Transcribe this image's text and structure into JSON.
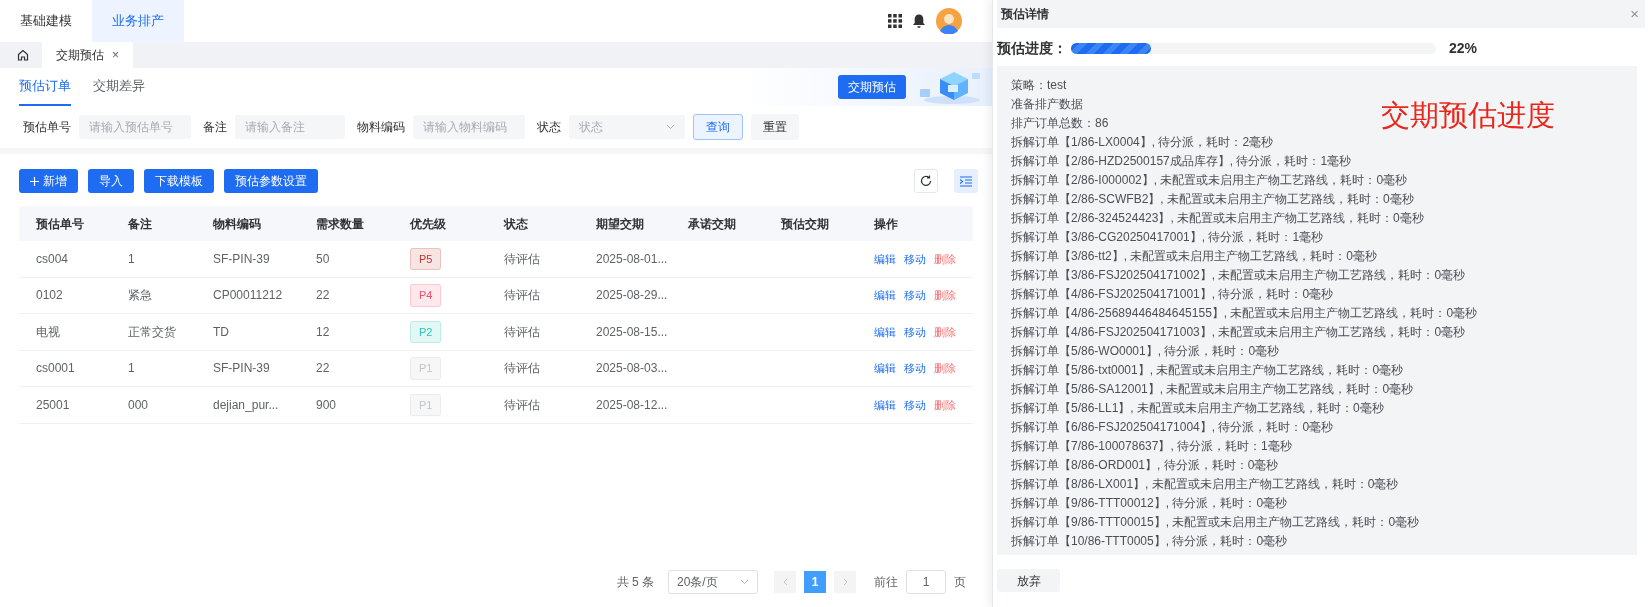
{
  "top_nav": [
    {
      "label": "基础建模",
      "selected": false
    },
    {
      "label": "业务排产",
      "selected": true
    }
  ],
  "page_tabs": [
    {
      "label": "交期预估",
      "selected": true,
      "close": "×"
    }
  ],
  "sub_tabs": [
    {
      "label": "预估订单",
      "selected": true
    },
    {
      "label": "交期差异",
      "selected": false
    }
  ],
  "banner_button": "交期预估",
  "filters": [
    {
      "kind": "input",
      "label": "预估单号",
      "placeholder": "请输入预估单号"
    },
    {
      "kind": "input",
      "label": "备注",
      "placeholder": "请输入备注"
    },
    {
      "kind": "input",
      "label": "物料编码",
      "placeholder": "请输入物料编码"
    },
    {
      "kind": "select",
      "label": "状态",
      "placeholder": "状态"
    }
  ],
  "filter_buttons": [
    {
      "kind": "primary",
      "label": "查询"
    },
    {
      "kind": "plain",
      "label": "重置"
    }
  ],
  "toolbar_buttons": [
    {
      "kind": "add",
      "label": "新增"
    },
    {
      "kind": "plain",
      "label": "导入"
    },
    {
      "kind": "plain",
      "label": "下载模板"
    },
    {
      "kind": "plain",
      "label": "预估参数设置"
    }
  ],
  "table": {
    "columns": [
      "预估单号",
      "备注",
      "物料编码",
      "需求数量",
      "优先级",
      "状态",
      "期望交期",
      "承诺交期",
      "预估交期",
      "操作"
    ],
    "rows": [
      {
        "cells": [
          "cs004",
          "1",
          "SF-PIN-39",
          "50"
        ],
        "priority": {
          "label": "P5",
          "color": "#c0392b"
        },
        "status": "待评估",
        "expected": "2025-08-01...",
        "actions": [
          {
            "kind": "link",
            "label": "编辑"
          },
          {
            "kind": "link",
            "label": "移动"
          },
          {
            "kind": "danger",
            "label": "删除"
          }
        ]
      },
      {
        "cells": [
          "0102",
          "紧急",
          "CP00011212",
          "22"
        ],
        "priority": {
          "label": "P4",
          "color": "#f0506e"
        },
        "status": "待评估",
        "expected": "2025-08-29...",
        "actions": [
          {
            "kind": "link",
            "label": "编辑"
          },
          {
            "kind": "link",
            "label": "移动"
          },
          {
            "kind": "danger",
            "label": "删除"
          }
        ]
      },
      {
        "cells": [
          "电视",
          "正常交货",
          "TD",
          "12"
        ],
        "priority": {
          "label": "P2",
          "color": "#2bc4b8"
        },
        "status": "待评估",
        "expected": "2025-08-15...",
        "actions": [
          {
            "kind": "link",
            "label": "编辑"
          },
          {
            "kind": "link",
            "label": "移动"
          },
          {
            "kind": "danger",
            "label": "删除"
          }
        ]
      },
      {
        "cells": [
          "cs0001",
          "1",
          "SF-PIN-39",
          "22"
        ],
        "priority": {
          "label": "P1",
          "color": "#c0c4cc"
        },
        "status": "待评估",
        "expected": "2025-08-03...",
        "actions": [
          {
            "kind": "link",
            "label": "编辑"
          },
          {
            "kind": "link",
            "label": "移动"
          },
          {
            "kind": "danger",
            "label": "删除"
          }
        ]
      },
      {
        "cells": [
          "25001",
          "000",
          "dejian_pur...",
          "900"
        ],
        "priority": {
          "label": "P1",
          "color": "#c0c4cc"
        },
        "status": "待评估",
        "expected": "2025-08-12...",
        "actions": [
          {
            "kind": "link",
            "label": "编辑"
          },
          {
            "kind": "link",
            "label": "移动"
          },
          {
            "kind": "danger",
            "label": "删除"
          }
        ]
      }
    ]
  },
  "pagination": {
    "total": "共 5 条",
    "page_size": "20条/页",
    "pages": [
      {
        "label": "1",
        "selected": true
      }
    ],
    "goto_label": "前往",
    "goto_value": "1",
    "goto_suffix": "页"
  },
  "drawer": {
    "title": "预估详情",
    "close": "×",
    "progress_label": "预估进度：",
    "level": 0.22,
    "reading": "22%",
    "annotation": "交期预估进度",
    "log": [
      "策略：test",
      "准备排产数据",
      "排产订单总数：86",
      "拆解订单【1/86-LX0004】, 待分派，耗时：2毫秒",
      "拆解订单【2/86-HZD2500157成品库存】, 待分派，耗时：1毫秒",
      "拆解订单【2/86-I000002】, 未配置或未启用主产物工艺路线，耗时：0毫秒",
      "拆解订单【2/86-SCWFB2】, 未配置或未启用主产物工艺路线，耗时：0毫秒",
      "拆解订单【2/86-324524423】, 未配置或未启用主产物工艺路线，耗时：0毫秒",
      "拆解订单【3/86-CG20250417001】, 待分派，耗时：1毫秒",
      "拆解订单【3/86-tt2】, 未配置或未启用主产物工艺路线，耗时：0毫秒",
      "拆解订单【3/86-FSJ202504171002】, 未配置或未启用主产物工艺路线，耗时：0毫秒",
      "拆解订单【4/86-FSJ202504171001】, 待分派，耗时：0毫秒",
      "拆解订单【4/86-25689446484645155】, 未配置或未启用主产物工艺路线，耗时：0毫秒",
      "拆解订单【4/86-FSJ202504171003】, 未配置或未启用主产物工艺路线，耗时：0毫秒",
      "拆解订单【5/86-WO0001】, 待分派，耗时：0毫秒",
      "拆解订单【5/86-txt0001】, 未配置或未启用主产物工艺路线，耗时：0毫秒",
      "拆解订单【5/86-SA12001】, 未配置或未启用主产物工艺路线，耗时：0毫秒",
      "拆解订单【5/86-LL1】, 未配置或未启用主产物工艺路线，耗时：0毫秒",
      "拆解订单【6/86-FSJ202504171004】, 待分派，耗时：0毫秒",
      "拆解订单【7/86-100078637】, 待分派，耗时：1毫秒",
      "拆解订单【8/86-ORD001】, 待分派，耗时：0毫秒",
      "拆解订单【8/86-LX001】, 未配置或未启用主产物工艺路线，耗时：0毫秒",
      "拆解订单【9/86-TTT00012】, 待分派，耗时：0毫秒",
      "拆解订单【9/86-TTT00015】, 未配置或未启用主产物工艺路线，耗时：0毫秒",
      "拆解订单【10/86-TTT0005】, 待分派，耗时：0毫秒"
    ],
    "cancel_button": "放弃"
  }
}
